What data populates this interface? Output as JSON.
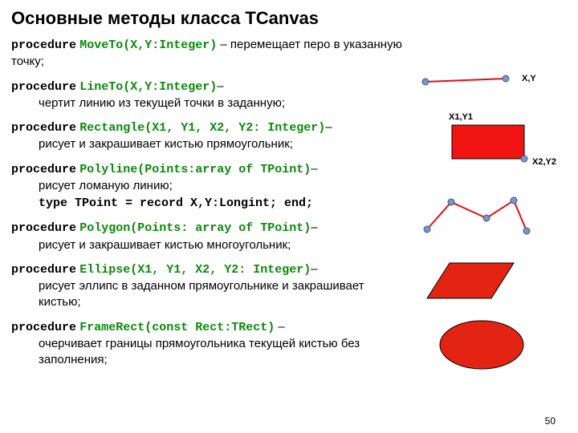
{
  "title": "Основные методы класса ТСanvas",
  "items": [
    {
      "kw": "procedure",
      "sig": "MoveTo(X,Y:Integer)",
      "dash": " – ",
      "desc": "перемещает перо в указанную точку;"
    },
    {
      "kw": "procedure",
      "sig": "LineTo(X,Y:Integer)",
      "dash": "– ",
      "desc": "чертит линию из текущей точки в заданную;"
    },
    {
      "kw": "procedure",
      "sig": "Rectangle(X1, Y1, X2, Y2: Integer)",
      "dash": "– ",
      "desc": "рисует и закрашивает кистью прямоугольник;"
    },
    {
      "kw": "procedure",
      "sig": "Polyline(Points:array of TPoint)",
      "dash": "– ",
      "desc": "рисует ломаную линию;"
    },
    {
      "kw": "procedure",
      "sig": "Polygon(Points: array of TPoint)",
      "dash": "– ",
      "desc": "рисует и закрашивает кистью многоугольник;"
    },
    {
      "kw": "procedure",
      "sig": "Ellipse(X1, Y1, X2, Y2: Integer)",
      "dash": "– ",
      "desc": "рисует эллипс в заданном прямоугольнике и закрашивает кистью;"
    },
    {
      "kw": "procedure",
      "sig": "FrameRect(const Rect:TRect)",
      "dash": " – ",
      "desc": "очерчивает границы прямоугольника текущей кистью без заполнения;"
    }
  ],
  "typeline": "type TPoint = record  X,Y:Longint; end;",
  "labels": {
    "xy": "X,Y",
    "x1y1": "X1,Y1",
    "x2y2": "X2,Y2"
  },
  "pagenum": "50"
}
